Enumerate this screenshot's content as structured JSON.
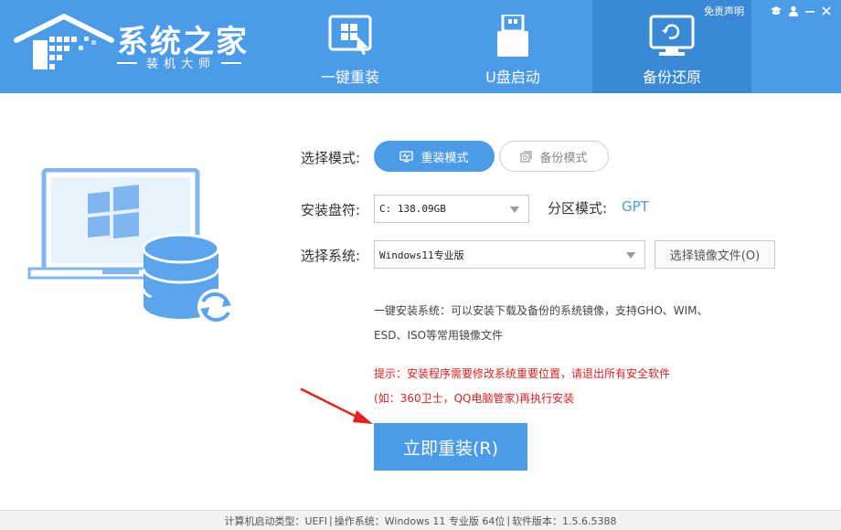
{
  "header": {
    "logo_title": "系统之家",
    "logo_subtitle": "装机大师",
    "tabs": [
      {
        "label": "一键重装",
        "icon": "windows-install-icon"
      },
      {
        "label": "U盘启动",
        "icon": "usb-drive-icon"
      },
      {
        "label": "备份还原",
        "icon": "backup-restore-icon"
      }
    ],
    "top_links": {
      "disclaimer": "免责声明",
      "graduation_icon": "graduation-cap-icon",
      "user_icon": "user-icon",
      "minimize_icon": "minimize-icon",
      "close_icon": "close-icon"
    }
  },
  "form": {
    "mode_label": "选择模式:",
    "mode_options": [
      {
        "label": "重装模式",
        "icon": "pulse-monitor-icon",
        "selected": true
      },
      {
        "label": "备份模式",
        "icon": "backup-copy-icon",
        "selected": false
      }
    ],
    "disk_label": "安装盘符:",
    "disk_value": "C: 138.09GB",
    "partition_label": "分区模式:",
    "partition_value": "GPT",
    "system_label": "选择系统:",
    "system_value": "Windows11专业版",
    "browse_label": "选择镜像文件(O)"
  },
  "description": {
    "line1": "一键安装系统：可以安装下载及备份的系统镜像，支持GHO、WIM、",
    "line2": "ESD、ISO等常用镜像文件"
  },
  "warning": {
    "line1": "提示：安装程序需要修改系统重要位置，请退出所有安全软件",
    "line2": "(如：360卫士，QQ电脑管家)再执行安装"
  },
  "install_button": "立即重装(R)",
  "footer": {
    "boot_type": "计算机启动类型：UEFI",
    "os": "操作系统：Windows 11 专业版 64位",
    "version": "软件版本：1.5.6.5388",
    "separator": "|"
  },
  "colors": {
    "brand_blue": "#4c9be8",
    "active_tab": "#3a89d6",
    "warning_red": "#e02020"
  }
}
